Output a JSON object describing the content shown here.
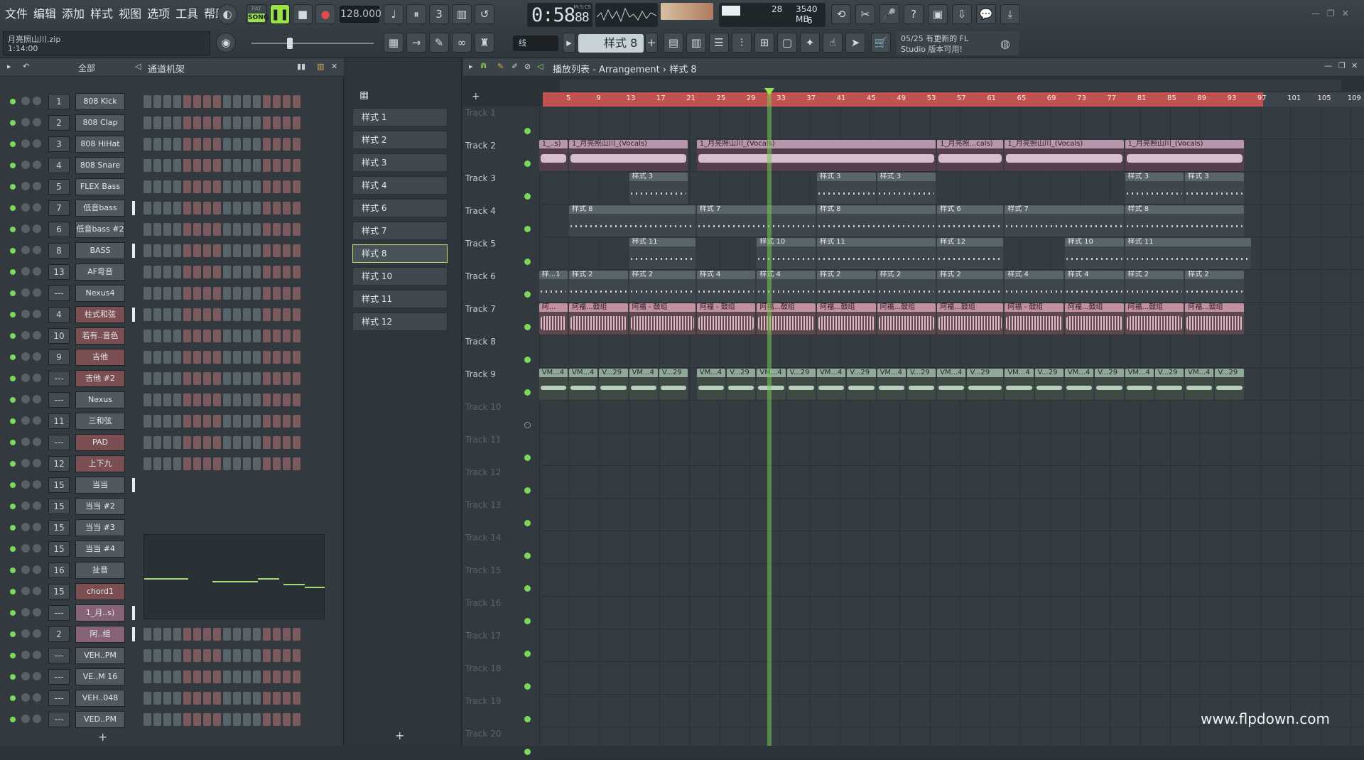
{
  "menu": [
    "文件",
    "编辑",
    "添加",
    "样式",
    "视图",
    "选项",
    "工具",
    "帮助"
  ],
  "transport": {
    "pat_label": "PAT",
    "song_label": "SONG",
    "tempo": "128.000"
  },
  "time": {
    "value": "0:58",
    "fraction": "88",
    "unit": "M:S:CS"
  },
  "cpu": {
    "ram": "3540 MB",
    "cores": "28",
    "polyphony": "6"
  },
  "file": {
    "name": "月亮照山川.zip",
    "duration": "1:14:00"
  },
  "snap": "线",
  "pattern_selector": "样式 8",
  "news": {
    "line1": "05/25  有更新的 FL",
    "line2": "Studio 版本可用!"
  },
  "rack": {
    "group": "全部",
    "title": "通道机架",
    "channels": [
      {
        "num": "1",
        "name": "808 Kick",
        "color": "grey",
        "sel": false
      },
      {
        "num": "2",
        "name": "808 Clap",
        "color": "grey",
        "sel": false
      },
      {
        "num": "3",
        "name": "808 HiHat",
        "color": "grey",
        "sel": false
      },
      {
        "num": "4",
        "name": "808 Snare",
        "color": "grey",
        "sel": false
      },
      {
        "num": "5",
        "name": "FLEX Bass",
        "color": "grey",
        "sel": false
      },
      {
        "num": "7",
        "name": "低音bass",
        "color": "grey",
        "sel": true
      },
      {
        "num": "6",
        "name": "低音bass #2",
        "color": "grey",
        "sel": false
      },
      {
        "num": "8",
        "name": "BASS",
        "color": "grey",
        "sel": true
      },
      {
        "num": "13",
        "name": "AF弯音",
        "color": "grey",
        "sel": false
      },
      {
        "num": "---",
        "name": "Nexus4",
        "color": "grey",
        "sel": false
      },
      {
        "num": "4",
        "name": "柱式和弦",
        "color": "red",
        "sel": true
      },
      {
        "num": "10",
        "name": "若有..音色",
        "color": "red",
        "sel": false
      },
      {
        "num": "9",
        "name": "吉他",
        "color": "red",
        "sel": false
      },
      {
        "num": "---",
        "name": "吉他 #2",
        "color": "red",
        "sel": false
      },
      {
        "num": "---",
        "name": "Nexus",
        "color": "grey",
        "sel": false
      },
      {
        "num": "11",
        "name": "三和弦",
        "color": "grey",
        "sel": false
      },
      {
        "num": "---",
        "name": "PAD",
        "color": "red",
        "sel": false
      },
      {
        "num": "12",
        "name": "上下九",
        "color": "red",
        "sel": false
      },
      {
        "num": "15",
        "name": "当当",
        "color": "grey",
        "sel": true
      },
      {
        "num": "15",
        "name": "当当 #2",
        "color": "grey",
        "sel": false
      },
      {
        "num": "15",
        "name": "当当 #3",
        "color": "grey",
        "sel": false
      },
      {
        "num": "15",
        "name": "当当 #4",
        "color": "grey",
        "sel": false
      },
      {
        "num": "16",
        "name": "扯音",
        "color": "grey",
        "sel": false
      },
      {
        "num": "15",
        "name": "chord1",
        "color": "red",
        "sel": false
      },
      {
        "num": "---",
        "name": "1_月..s)",
        "color": "purple",
        "sel": true
      },
      {
        "num": "2",
        "name": "阿..组",
        "color": "purple",
        "sel": true
      },
      {
        "num": "---",
        "name": "VEH..PM",
        "color": "grey",
        "sel": false
      },
      {
        "num": "---",
        "name": "VE..M 16",
        "color": "grey",
        "sel": false
      },
      {
        "num": "---",
        "name": "VEH..048",
        "color": "grey",
        "sel": false
      },
      {
        "num": "---",
        "name": "VED..PM",
        "color": "grey",
        "sel": false
      }
    ]
  },
  "patterns": [
    "样式 1",
    "样式 2",
    "样式 3",
    "样式 4",
    "样式 6",
    "样式 7",
    "样式 8",
    "样式 10",
    "样式 11",
    "样式 12"
  ],
  "active_pattern_index": 6,
  "playlist": {
    "title": "播放列表 - Arrangement › 样式 8",
    "ruler": [
      "5",
      "9",
      "13",
      "17",
      "21",
      "25",
      "29",
      "33",
      "37",
      "41",
      "45",
      "49",
      "53",
      "57",
      "61",
      "65",
      "69",
      "73",
      "77",
      "81",
      "85",
      "89",
      "93",
      "97",
      "101",
      "105",
      "109"
    ],
    "tracks": [
      "Track 1",
      "Track 2",
      "Track 3",
      "Track 4",
      "Track 5",
      "Track 6",
      "Track 7",
      "Track 8",
      "Track 9",
      "Track 10",
      "Track 11",
      "Track 12",
      "Track 13",
      "Track 14",
      "Track 15",
      "Track 16",
      "Track 17",
      "Track 18",
      "Track 19",
      "Track 20"
    ],
    "clips": [
      {
        "t": 1,
        "s": 1,
        "e": 5,
        "k": "vox",
        "l": "1_..s)"
      },
      {
        "t": 1,
        "s": 5,
        "e": 21,
        "k": "vox",
        "l": "1_月亮照山川_(Vocals)"
      },
      {
        "t": 1,
        "s": 22,
        "e": 54,
        "k": "vox",
        "l": "1_月亮照山川_(Vocals)"
      },
      {
        "t": 1,
        "s": 54,
        "e": 63,
        "k": "vox",
        "l": "1_月亮照...cals)"
      },
      {
        "t": 1,
        "s": 63,
        "e": 79,
        "k": "vox",
        "l": "1_月亮照山川_(Vocals)"
      },
      {
        "t": 1,
        "s": 79,
        "e": 95,
        "k": "vox",
        "l": "1_月亮照山川_(Vocals)"
      },
      {
        "t": 2,
        "s": 13,
        "e": 21,
        "k": "pat",
        "l": "样式 3"
      },
      {
        "t": 2,
        "s": 38,
        "e": 46,
        "k": "pat",
        "l": "样式 3"
      },
      {
        "t": 2,
        "s": 46,
        "e": 54,
        "k": "pat",
        "l": "样式 3"
      },
      {
        "t": 2,
        "s": 79,
        "e": 87,
        "k": "pat",
        "l": "样式 3"
      },
      {
        "t": 2,
        "s": 87,
        "e": 95,
        "k": "pat",
        "l": "样式 3"
      },
      {
        "t": 3,
        "s": 5,
        "e": 22,
        "k": "pat",
        "l": "样式 8"
      },
      {
        "t": 3,
        "s": 22,
        "e": 38,
        "k": "pat",
        "l": "样式 7"
      },
      {
        "t": 3,
        "s": 38,
        "e": 54,
        "k": "pat",
        "l": "样式 8"
      },
      {
        "t": 3,
        "s": 54,
        "e": 63,
        "k": "pat",
        "l": "样式 6"
      },
      {
        "t": 3,
        "s": 63,
        "e": 79,
        "k": "pat",
        "l": "样式 7"
      },
      {
        "t": 3,
        "s": 79,
        "e": 95,
        "k": "pat",
        "l": "样式 8"
      },
      {
        "t": 4,
        "s": 13,
        "e": 22,
        "k": "pat",
        "l": "样式 11"
      },
      {
        "t": 4,
        "s": 30,
        "e": 38,
        "k": "pat",
        "l": "样式 10"
      },
      {
        "t": 4,
        "s": 38,
        "e": 54,
        "k": "pat",
        "l": "样式 11"
      },
      {
        "t": 4,
        "s": 54,
        "e": 63,
        "k": "pat",
        "l": "样式 12"
      },
      {
        "t": 4,
        "s": 71,
        "e": 79,
        "k": "pat",
        "l": "样式 10"
      },
      {
        "t": 4,
        "s": 79,
        "e": 96,
        "k": "pat",
        "l": "样式 11"
      },
      {
        "t": 5,
        "s": 1,
        "e": 5,
        "k": "pat",
        "l": "样...1"
      },
      {
        "t": 5,
        "s": 5,
        "e": 13,
        "k": "pat",
        "l": "样式 2"
      },
      {
        "t": 5,
        "s": 13,
        "e": 22,
        "k": "pat",
        "l": "样式 2"
      },
      {
        "t": 5,
        "s": 22,
        "e": 30,
        "k": "pat",
        "l": "样式 4"
      },
      {
        "t": 5,
        "s": 30,
        "e": 38,
        "k": "pat",
        "l": "样式 4"
      },
      {
        "t": 5,
        "s": 38,
        "e": 46,
        "k": "pat",
        "l": "样式 2"
      },
      {
        "t": 5,
        "s": 46,
        "e": 54,
        "k": "pat",
        "l": "样式 2"
      },
      {
        "t": 5,
        "s": 54,
        "e": 63,
        "k": "pat",
        "l": "样式 2"
      },
      {
        "t": 5,
        "s": 63,
        "e": 71,
        "k": "pat",
        "l": "样式 4"
      },
      {
        "t": 5,
        "s": 71,
        "e": 79,
        "k": "pat",
        "l": "样式 4"
      },
      {
        "t": 5,
        "s": 79,
        "e": 87,
        "k": "pat",
        "l": "样式 2"
      },
      {
        "t": 5,
        "s": 87,
        "e": 95,
        "k": "pat",
        "l": "样式 2"
      },
      {
        "t": 6,
        "s": 1,
        "e": 5,
        "k": "drum",
        "l": "阿..."
      },
      {
        "t": 6,
        "s": 5,
        "e": 13,
        "k": "drum",
        "l": "阿福...鼓组"
      },
      {
        "t": 6,
        "s": 13,
        "e": 22,
        "k": "drum",
        "l": "阿福 - 鼓组"
      },
      {
        "t": 6,
        "s": 22,
        "e": 30,
        "k": "drum",
        "l": "阿福 - 鼓组"
      },
      {
        "t": 6,
        "s": 30,
        "e": 38,
        "k": "drum",
        "l": "阿福...鼓组"
      },
      {
        "t": 6,
        "s": 38,
        "e": 46,
        "k": "drum",
        "l": "阿福...鼓组"
      },
      {
        "t": 6,
        "s": 46,
        "e": 54,
        "k": "drum",
        "l": "阿福...鼓组"
      },
      {
        "t": 6,
        "s": 54,
        "e": 63,
        "k": "drum",
        "l": "阿福...鼓组"
      },
      {
        "t": 6,
        "s": 63,
        "e": 71,
        "k": "drum",
        "l": "阿福 - 鼓组"
      },
      {
        "t": 6,
        "s": 71,
        "e": 79,
        "k": "drum",
        "l": "阿福...鼓组"
      },
      {
        "t": 6,
        "s": 79,
        "e": 87,
        "k": "drum",
        "l": "阿福...鼓组"
      },
      {
        "t": 6,
        "s": 87,
        "e": 95,
        "k": "drum",
        "l": "阿福...鼓组"
      },
      {
        "t": 8,
        "s": 1,
        "e": 5,
        "k": "vm",
        "l": "VM...4"
      },
      {
        "t": 8,
        "s": 5,
        "e": 9,
        "k": "vm",
        "l": "VM...4"
      },
      {
        "t": 8,
        "s": 9,
        "e": 13,
        "k": "vm",
        "l": "V...29"
      },
      {
        "t": 8,
        "s": 13,
        "e": 17,
        "k": "vm",
        "l": "VM...4"
      },
      {
        "t": 8,
        "s": 17,
        "e": 21,
        "k": "vm",
        "l": "V...29"
      },
      {
        "t": 8,
        "s": 22,
        "e": 26,
        "k": "vm",
        "l": "VM...4"
      },
      {
        "t": 8,
        "s": 26,
        "e": 30,
        "k": "vm",
        "l": "V...29"
      },
      {
        "t": 8,
        "s": 30,
        "e": 34,
        "k": "vm",
        "l": "VM...4"
      },
      {
        "t": 8,
        "s": 34,
        "e": 38,
        "k": "vm",
        "l": "V...29"
      },
      {
        "t": 8,
        "s": 38,
        "e": 42,
        "k": "vm",
        "l": "VM...4"
      },
      {
        "t": 8,
        "s": 42,
        "e": 46,
        "k": "vm",
        "l": "V...29"
      },
      {
        "t": 8,
        "s": 46,
        "e": 50,
        "k": "vm",
        "l": "VM...4"
      },
      {
        "t": 8,
        "s": 50,
        "e": 54,
        "k": "vm",
        "l": "V...29"
      },
      {
        "t": 8,
        "s": 54,
        "e": 58,
        "k": "vm",
        "l": "VM...4"
      },
      {
        "t": 8,
        "s": 58,
        "e": 63,
        "k": "vm",
        "l": "V...29"
      },
      {
        "t": 8,
        "s": 63,
        "e": 67,
        "k": "vm",
        "l": "VM...4"
      },
      {
        "t": 8,
        "s": 67,
        "e": 71,
        "k": "vm",
        "l": "V...29"
      },
      {
        "t": 8,
        "s": 71,
        "e": 75,
        "k": "vm",
        "l": "VM...4"
      },
      {
        "t": 8,
        "s": 75,
        "e": 79,
        "k": "vm",
        "l": "V...29"
      },
      {
        "t": 8,
        "s": 79,
        "e": 83,
        "k": "vm",
        "l": "VM...4"
      },
      {
        "t": 8,
        "s": 83,
        "e": 87,
        "k": "vm",
        "l": "V...29"
      },
      {
        "t": 8,
        "s": 87,
        "e": 91,
        "k": "vm",
        "l": "VM...4"
      },
      {
        "t": 8,
        "s": 91,
        "e": 95,
        "k": "vm",
        "l": "V...29"
      }
    ]
  },
  "watermark": "www.flpdown.com",
  "colors": {
    "accent_green": "#9be24a",
    "ruler_red": "#c05250"
  }
}
